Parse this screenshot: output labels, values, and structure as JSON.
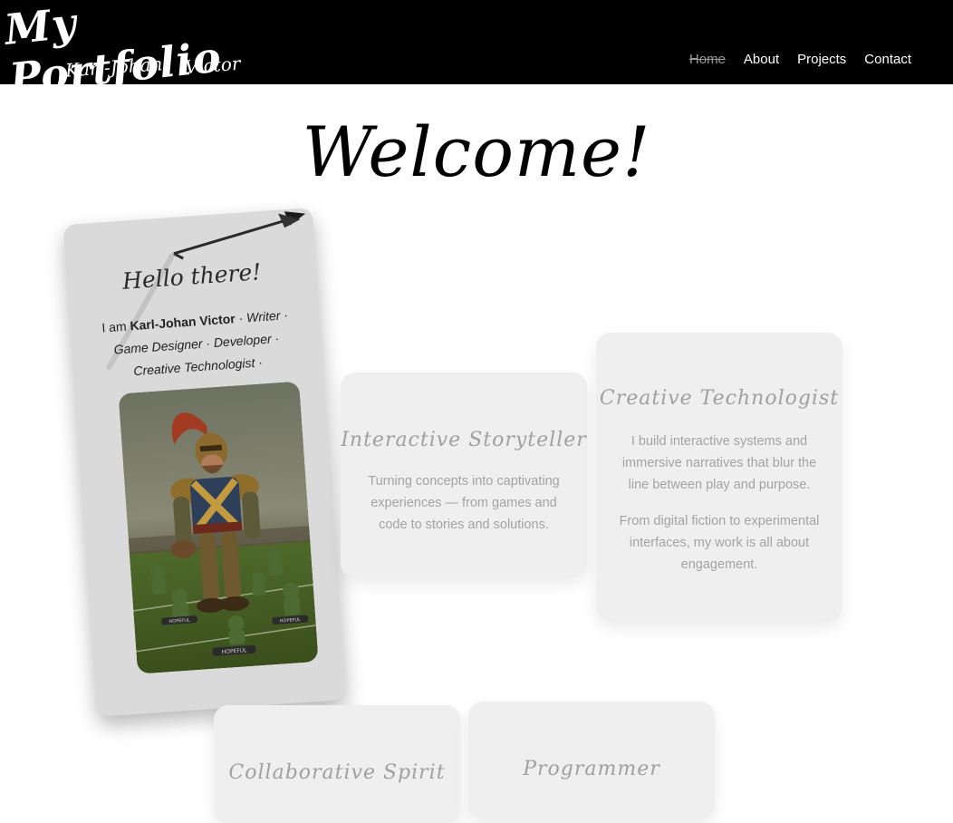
{
  "header": {
    "logo_title": "My Portfolio",
    "logo_first": "Karl-Johan",
    "logo_last": "Victor",
    "nav": [
      {
        "label": "Home",
        "active": true
      },
      {
        "label": "About"
      },
      {
        "label": "Projects"
      },
      {
        "label": "Contact"
      }
    ]
  },
  "welcome": "Welcome!",
  "profile": {
    "greeting": "Hello there!",
    "intro_prefix": "I am ",
    "name": "Karl-Johan Victor",
    "sep1": " · ",
    "role1": "Writer",
    "sep2": " · ",
    "role2": "Game Designer",
    "sep3": " · ",
    "role3": "Developer",
    "sep4": " · ",
    "role4": "Creative Technologist",
    "sep5": " ·",
    "base_label_left": "HOPEFUL",
    "base_label_center": "HOPEFUL",
    "base_label_right": "HOPEFUL"
  },
  "cards": {
    "storyteller": {
      "title": "Interactive Storyteller",
      "text": "Turning concepts into captivating experiences — from games and code to stories and solutions."
    },
    "technologist": {
      "title": "Creative Technologist",
      "text1": "I build interactive systems and immersive narratives that blur the line between play and purpose.",
      "text2": "From digital fiction to experimental interfaces, my work is all about engagement."
    },
    "collab": {
      "title": "Collaborative Spirit"
    },
    "programmer": {
      "title": "Programmer"
    }
  },
  "colors": {
    "header_bg": "#000000",
    "card_bg": "#efefef",
    "profile_bg": "#dadada",
    "muted_text": "#a0a0a0"
  }
}
